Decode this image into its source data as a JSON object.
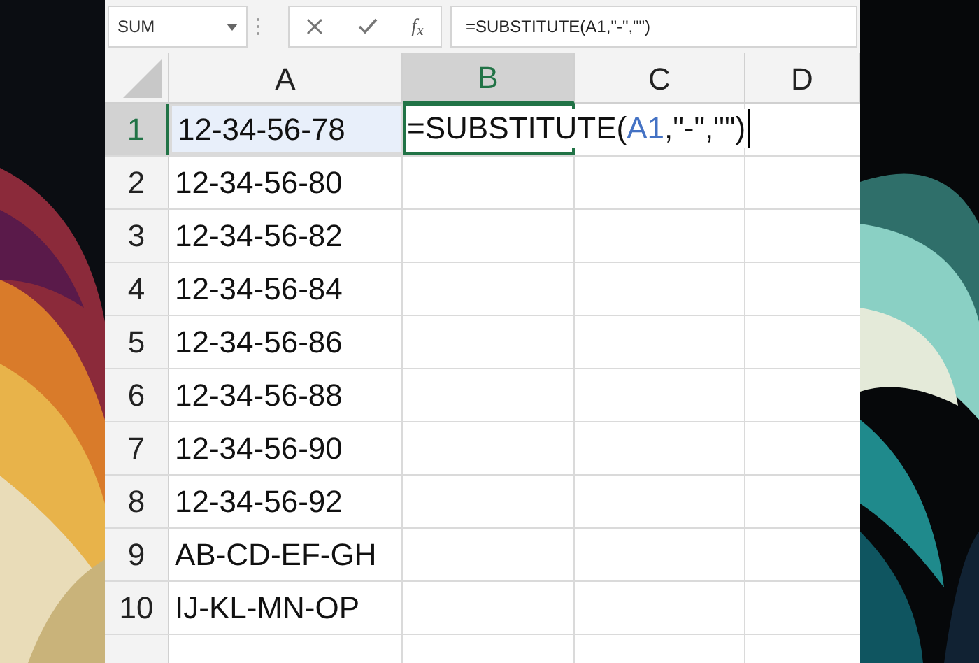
{
  "name_box": {
    "value": "SUM"
  },
  "formula_bar": {
    "function_label": "f$_{x}$",
    "value": "=SUBSTITUTE(A1,\"-\",\"\")"
  },
  "columns": [
    {
      "label": "A",
      "selected": false
    },
    {
      "label": "B",
      "selected": true
    },
    {
      "label": "C",
      "selected": false
    },
    {
      "label": "D",
      "selected": false
    }
  ],
  "rows": [
    {
      "label": "1",
      "selected": true,
      "value": "12-34-56-78",
      "referenced": true
    },
    {
      "label": "2",
      "selected": false,
      "value": "12-34-56-80",
      "referenced": false
    },
    {
      "label": "3",
      "selected": false,
      "value": "12-34-56-82",
      "referenced": false
    },
    {
      "label": "4",
      "selected": false,
      "value": "12-34-56-84",
      "referenced": false
    },
    {
      "label": "5",
      "selected": false,
      "value": "12-34-56-86",
      "referenced": false
    },
    {
      "label": "6",
      "selected": false,
      "value": "12-34-56-88",
      "referenced": false
    },
    {
      "label": "7",
      "selected": false,
      "value": "12-34-56-90",
      "referenced": false
    },
    {
      "label": "8",
      "selected": false,
      "value": "12-34-56-92",
      "referenced": false
    },
    {
      "label": "9",
      "selected": false,
      "value": "AB-CD-EF-GH",
      "referenced": false
    },
    {
      "label": "10",
      "selected": false,
      "value": "IJ-KL-MN-OP",
      "referenced": false
    }
  ],
  "active_cell": {
    "segments": [
      {
        "text": "=SUBSTITUTE(",
        "kind": "plain"
      },
      {
        "text": "A1",
        "kind": "reference"
      },
      {
        "text": ",\"-\",\"\")",
        "kind": "plain"
      }
    ]
  }
}
